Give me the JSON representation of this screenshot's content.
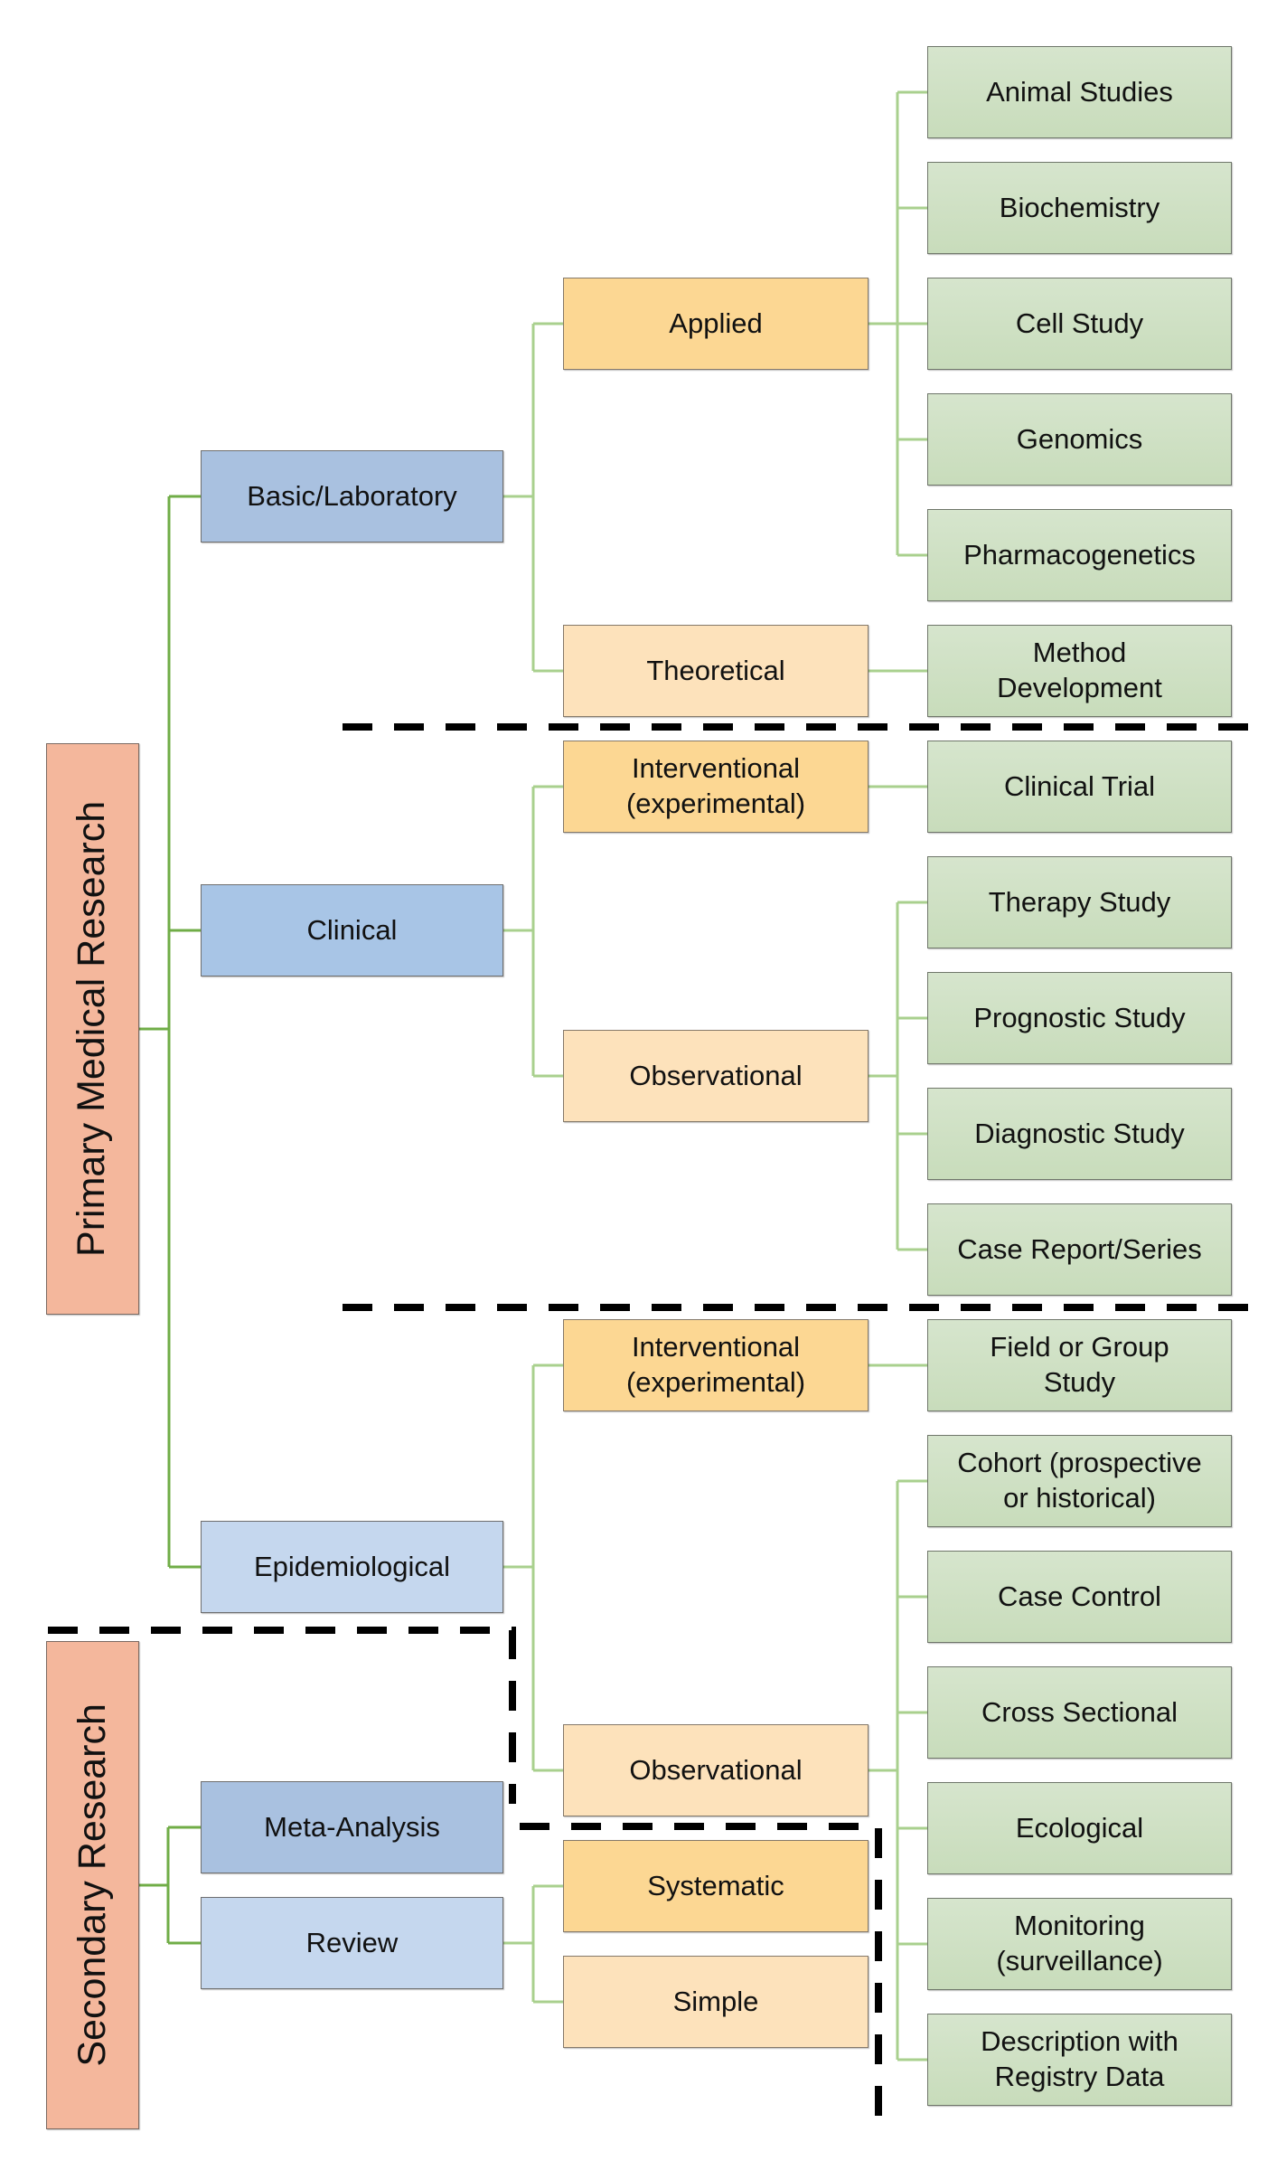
{
  "diagram": {
    "type": "classification tree",
    "roots": {
      "primary": "Primary Medical Research",
      "secondary": "Secondary Research"
    },
    "level1": {
      "basic": "Basic/Laboratory",
      "clinical": "Clinical",
      "epidemiological": "Epidemiological",
      "meta_analysis": "Meta-Analysis",
      "review": "Review"
    },
    "level2": {
      "applied": "Applied",
      "theoretical": "Theoretical",
      "clinical_interventional": "Interventional\n(experimental)",
      "clinical_observational": "Observational",
      "epi_interventional": "Interventional\n(experimental)",
      "epi_observational": "Observational",
      "systematic": "Systematic",
      "simple": "Simple"
    },
    "level3": {
      "animal_studies": "Animal Studies",
      "biochemistry": "Biochemistry",
      "cell_study": "Cell Study",
      "genomics": "Genomics",
      "pharmacogenetics": "Pharmacogenetics",
      "method_development": "Method\nDevelopment",
      "clinical_trial": "Clinical Trial",
      "therapy_study": "Therapy Study",
      "prognostic_study": "Prognostic Study",
      "diagnostic_study": "Diagnostic Study",
      "case_report": "Case Report/Series",
      "field_group_study": "Field or Group\nStudy",
      "cohort": "Cohort (prospective\nor historical)",
      "case_control": "Case Control",
      "cross_sectional": "Cross Sectional",
      "ecological": "Ecological",
      "monitoring": "Monitoring\n(surveillance)",
      "registry": "Description with\nRegistry Data"
    },
    "colors": {
      "root": "#f4b79c",
      "level1_dark": "#a9c1e0",
      "level1_light": "#c5d7ee",
      "level2_strong": "#fcd793",
      "level2_soft": "#fde2bb",
      "level3": "#cfe0c4",
      "trunk_connector": "#70ad47",
      "branch_connector": "#a9d08e",
      "separator": "#000000"
    }
  }
}
